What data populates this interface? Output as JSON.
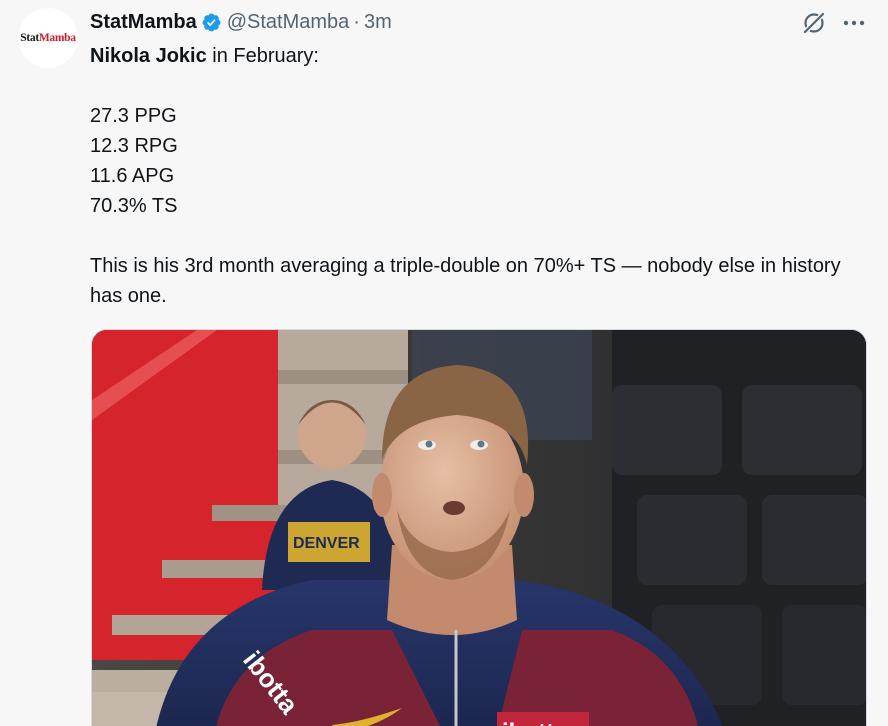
{
  "tweet": {
    "avatar_text_part1": "Stat",
    "avatar_text_part2": "Mamba",
    "display_name": "StatMamba",
    "handle": "@StatMamba",
    "separator": "·",
    "time": "3m",
    "text": {
      "player_name": "Nikola Jokic",
      "intro_rest": " in February:",
      "stats": [
        "27.3 PPG",
        "12.3 RPG",
        "11.6 APG",
        "70.3% TS"
      ],
      "summary": "This is his 3rd month averaging a triple-double on 70%+ TS — nobody else in history has one."
    },
    "media": {
      "jersey_sponsor_text": "ibotta",
      "background_jersey_text": "DENVER"
    }
  },
  "colors": {
    "verified_blue": "#1d9bf0",
    "text_primary": "#0f1419",
    "text_secondary": "#536471",
    "avatar_accent": "#d11a2a"
  },
  "icons": {
    "verified": "verified-badge-icon",
    "grok": "grok-icon",
    "more": "more-icon"
  }
}
